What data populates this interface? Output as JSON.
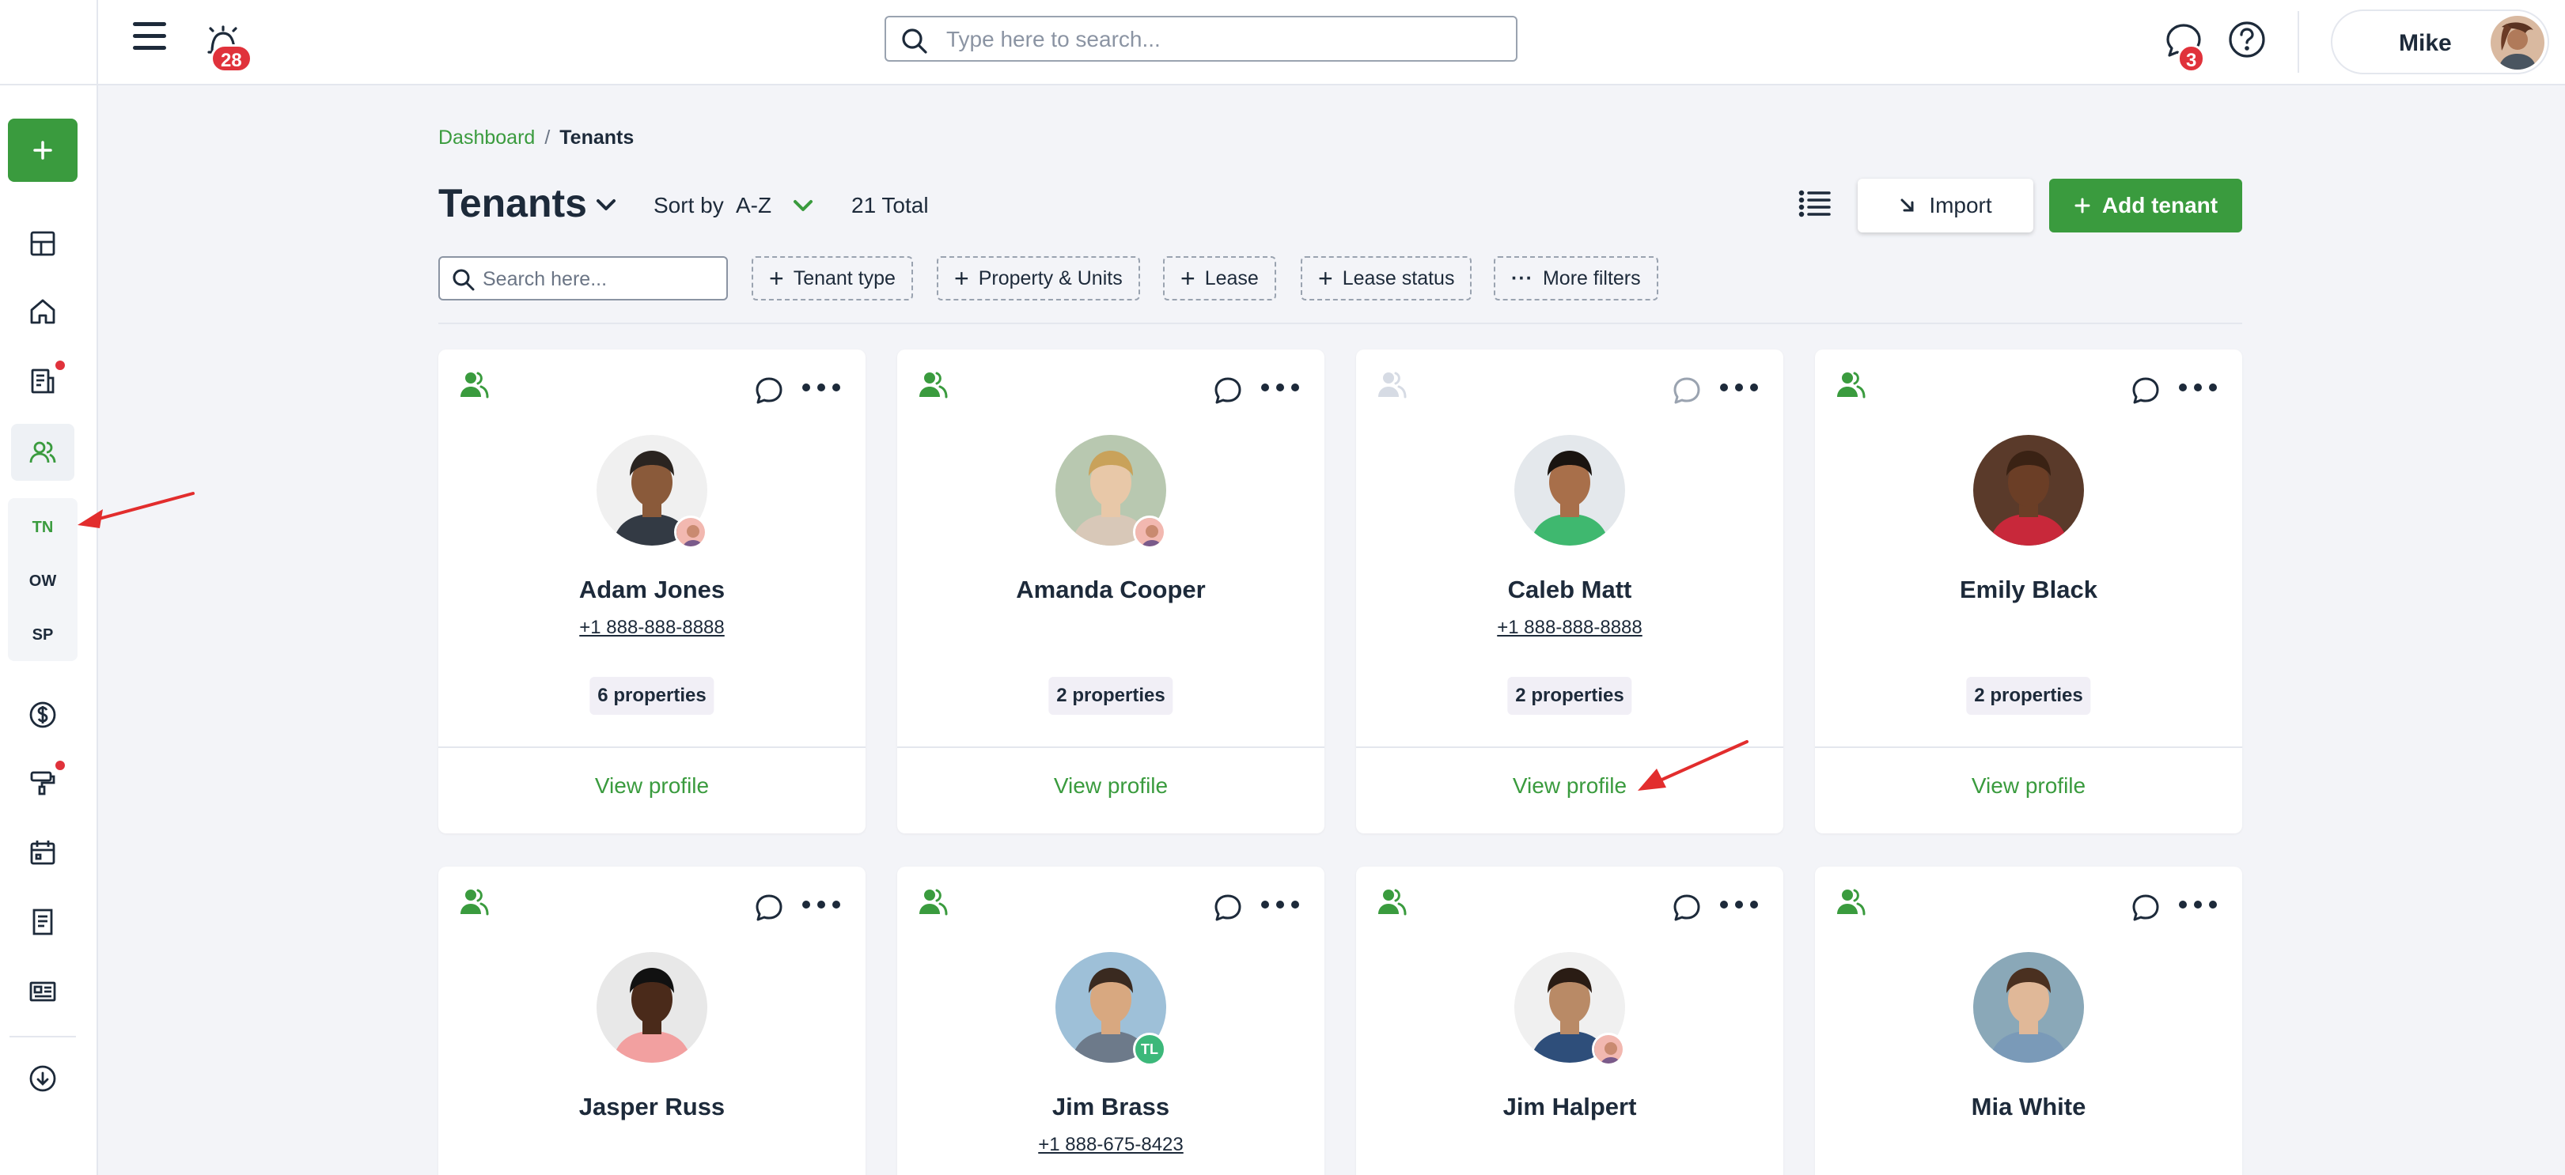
{
  "topbar": {
    "notification_count": "28",
    "search_placeholder": "Type here to search...",
    "message_count": "3",
    "user_name": "Mike"
  },
  "sidebar": {
    "sub_nav": [
      {
        "label": "TN",
        "active": true
      },
      {
        "label": "OW",
        "active": false
      },
      {
        "label": "SP",
        "active": false
      }
    ]
  },
  "breadcrumb": {
    "root": "Dashboard",
    "separator": "/",
    "current": "Tenants"
  },
  "header": {
    "title": "Tenants",
    "sort_label": "Sort by",
    "sort_value": "A-Z",
    "total": "21 Total",
    "import_label": "Import",
    "add_label": "Add tenant"
  },
  "filters": {
    "search_placeholder": "Search here...",
    "chips": [
      "Tenant type",
      "Property & Units",
      "Lease",
      "Lease status",
      "More filters"
    ]
  },
  "cards": [
    {
      "name": "Adam Jones",
      "phone": "+1 888-888-8888",
      "properties": "6 properties",
      "action": "View profile",
      "active": true
    },
    {
      "name": "Amanda Cooper",
      "phone": "",
      "properties": "2 properties",
      "action": "View profile",
      "active": true
    },
    {
      "name": "Caleb Matt",
      "phone": "+1 888-888-8888",
      "properties": "2 properties",
      "action": "View profile",
      "active": false
    },
    {
      "name": "Emily Black",
      "phone": "",
      "properties": "2 properties",
      "action": "View profile",
      "active": true
    },
    {
      "name": "Jasper Russ",
      "phone": "",
      "properties": "",
      "action": "",
      "active": true
    },
    {
      "name": "Jim Brass",
      "phone": "+1 888-675-8423",
      "properties": "",
      "action": "",
      "active": true,
      "tag": "TL"
    },
    {
      "name": "Jim Halpert",
      "phone": "",
      "properties": "",
      "action": "",
      "active": true
    },
    {
      "name": "Mia White",
      "phone": "",
      "properties": "",
      "action": "",
      "active": true
    }
  ],
  "colors": {
    "brand_green": "#3a9b3e",
    "badge_red": "#e0323b",
    "text_dark": "#1d2a3a",
    "page_bg": "#f3f4f8"
  }
}
